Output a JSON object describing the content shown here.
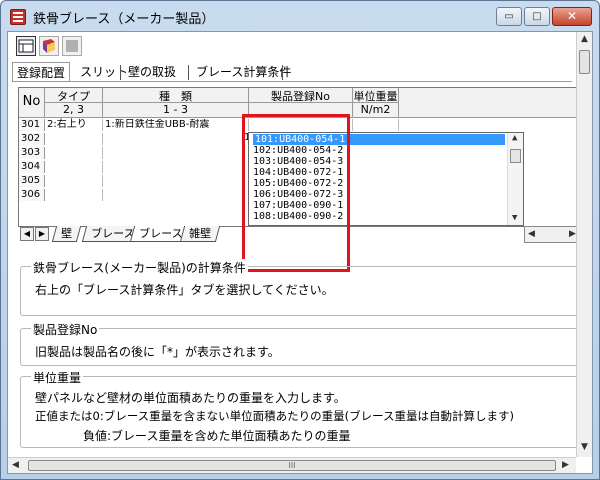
{
  "window": {
    "title": "鉄骨ブレース（メーカー製品）",
    "min_glyph": "▭",
    "max_glyph": "□",
    "close_glyph": "✕"
  },
  "tabs": [
    "登録配置",
    "スリット",
    "壁の取扱",
    "ブレース計算条件"
  ],
  "grid": {
    "headers": {
      "no": "No",
      "type": "タイプ",
      "kind": "種　類",
      "product": "製品登録No",
      "unit_weight": "単位重量"
    },
    "subheaders": {
      "type": "2, 3",
      "kind": "1 - 3",
      "unit_weight": "N/m2"
    },
    "rows": [
      {
        "no": "301",
        "type": "2:右上り",
        "kind": "1:新日鉄住金UBB-耐震"
      },
      {
        "no": "302",
        "type": "",
        "kind": ""
      },
      {
        "no": "303",
        "type": "",
        "kind": ""
      },
      {
        "no": "304",
        "type": "",
        "kind": ""
      },
      {
        "no": "305",
        "type": "",
        "kind": ""
      },
      {
        "no": "306",
        "type": "",
        "kind": ""
      }
    ],
    "dropdown_prefix": "1",
    "dropdown_items": [
      "101:UB400-054-1",
      "102:UB400-054-2",
      "103:UB400-054-3",
      "104:UB400-072-1",
      "105:UB400-072-2",
      "106:UB400-072-3",
      "107:UB400-090-1",
      "108:UB400-090-2"
    ]
  },
  "sheets": [
    "壁",
    "ブレース1",
    "ブレース2",
    "雑壁"
  ],
  "groups": {
    "calc": {
      "title": "鉄骨ブレース(メーカー製品)の計算条件",
      "line1": "右上の「ブレース計算条件」タブを選択してください。"
    },
    "product": {
      "title": "製品登録No",
      "line1": "旧製品は製品名の後に「*」が表示されます。"
    },
    "unit": {
      "title": "単位重量",
      "line1": "壁パネルなど壁材の単位面積あたりの重量を入力します。",
      "line2": "正値または0:ブレース重量を含まない単位面積あたりの重量(ブレース重量は自動計算します)",
      "line3": "負値:ブレース重量を含めた単位面積あたりの重量"
    }
  },
  "scroll": {
    "hscroll_grip": "III"
  },
  "colors": {
    "highlight": "#e0141a",
    "selection": "#3399ff"
  }
}
